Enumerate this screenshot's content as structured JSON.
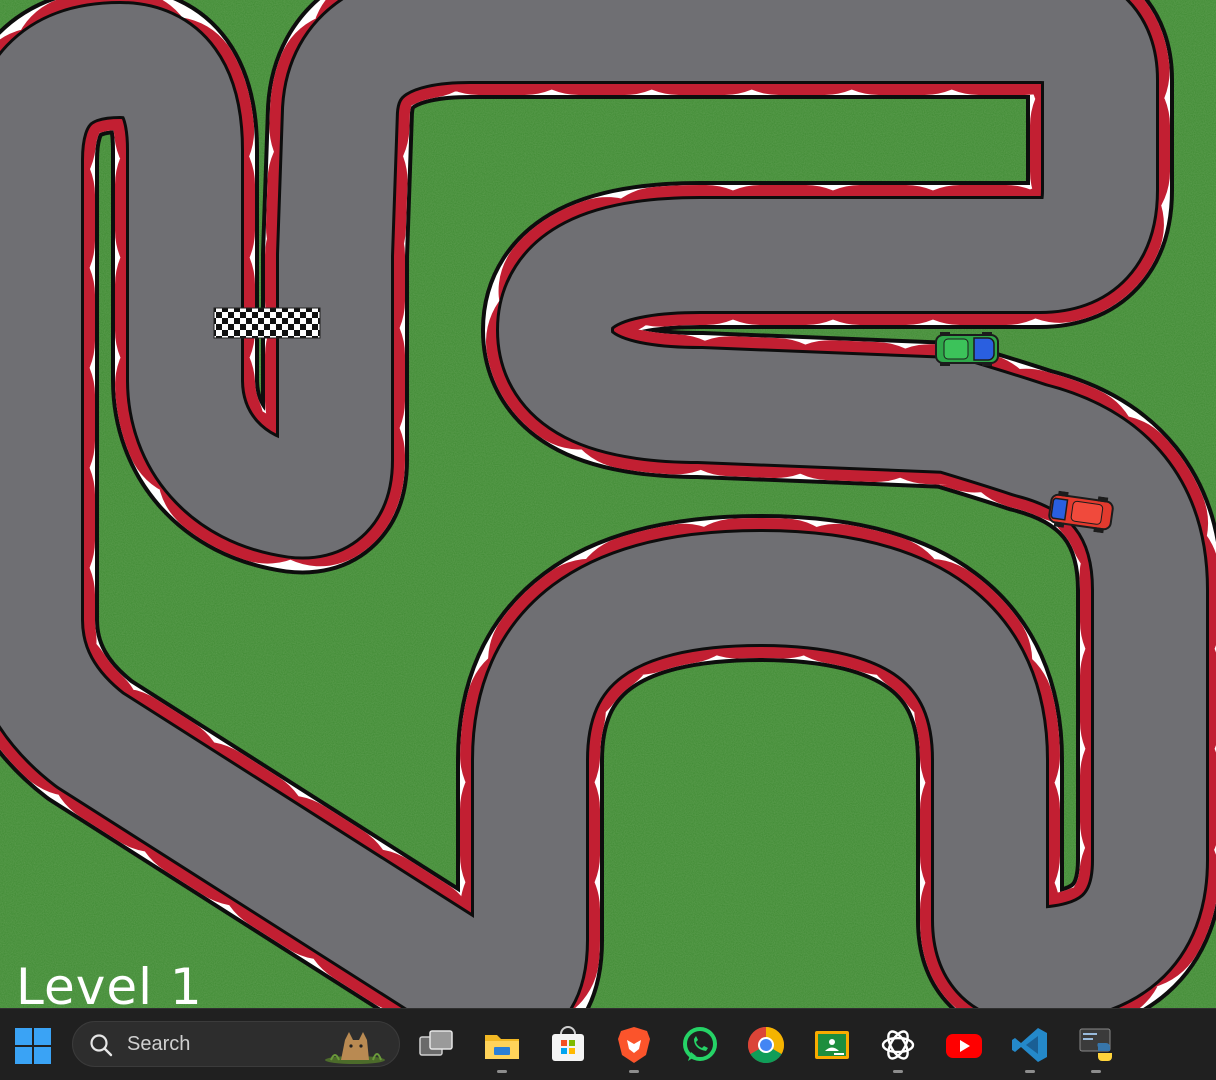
{
  "game": {
    "level_label": "Level 1",
    "colors": {
      "grass": "#3e8a32",
      "asphalt": "#6f6f73",
      "curb_red": "#c21f32",
      "curb_white": "#ffffff",
      "outline": "#0d0d0d"
    },
    "cars": [
      {
        "name": "player-car",
        "color": "#2fa84a",
        "accent": "#2a5fe0",
        "heading": "right"
      },
      {
        "name": "opponent-car",
        "color": "#e23a2e",
        "accent": "#2a5fe0",
        "heading": "right"
      }
    ],
    "finish_line": "checkered"
  },
  "taskbar": {
    "start_icon": "windows-logo-icon",
    "search_placeholder": "Search",
    "search_icon": "magnifier-icon",
    "pinned_apps": [
      {
        "name": "task-view",
        "icon": "task-view-icon",
        "running": false
      },
      {
        "name": "file-explorer",
        "icon": "folder-icon",
        "running": true
      },
      {
        "name": "microsoft-store",
        "icon": "store-icon",
        "running": false
      },
      {
        "name": "brave-browser",
        "icon": "brave-lion-icon",
        "running": true
      },
      {
        "name": "whatsapp",
        "icon": "whatsapp-icon",
        "running": false
      },
      {
        "name": "google-chrome",
        "icon": "chrome-icon",
        "running": false
      },
      {
        "name": "google-classroom",
        "icon": "classroom-icon",
        "running": false
      },
      {
        "name": "chatgpt",
        "icon": "openai-icon",
        "running": true
      },
      {
        "name": "youtube",
        "icon": "youtube-icon",
        "running": false
      },
      {
        "name": "vscode",
        "icon": "vscode-icon",
        "running": true
      },
      {
        "name": "python",
        "icon": "python-icon",
        "running": true
      }
    ]
  }
}
